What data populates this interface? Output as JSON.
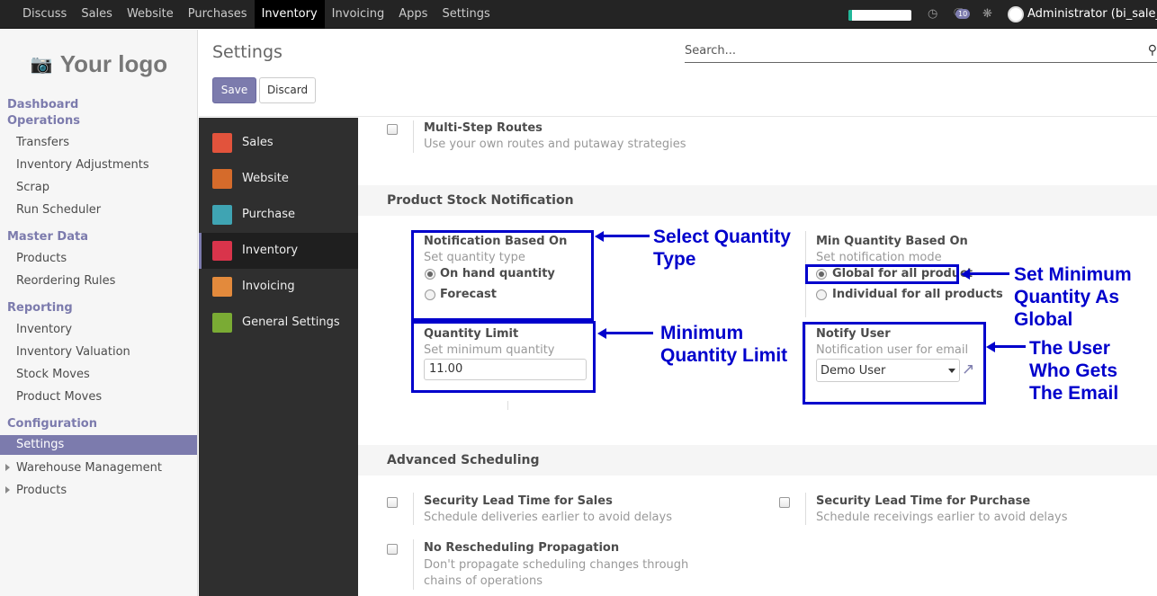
{
  "navbar": {
    "menu": [
      "Discuss",
      "Sales",
      "Website",
      "Purchases",
      "Inventory",
      "Invoicing",
      "Apps",
      "Settings"
    ],
    "active_menu": "Inventory",
    "progress_fraction": 0.05,
    "messages_count": "10",
    "user": "Administrator (bi_sale_..."
  },
  "sidebar": {
    "logo_text": "Your logo",
    "sections": [
      {
        "title": "Dashboard",
        "items": []
      },
      {
        "title": "Operations",
        "items": [
          "Transfers",
          "Inventory Adjustments",
          "Scrap",
          "Run Scheduler"
        ]
      },
      {
        "title": "Master Data",
        "items": [
          "Products",
          "Reordering Rules"
        ]
      },
      {
        "title": "Reporting",
        "items": [
          "Inventory",
          "Inventory Valuation",
          "Stock Moves",
          "Product Moves"
        ]
      },
      {
        "title": "Configuration",
        "items": [
          "Settings"
        ]
      }
    ],
    "active_item": "Settings",
    "tree_items": [
      "Warehouse Management",
      "Products"
    ]
  },
  "control_panel": {
    "title": "Settings",
    "search_placeholder": "Search...",
    "save_label": "Save",
    "discard_label": "Discard"
  },
  "apps": [
    {
      "label": "Sales",
      "color": "#e2533c"
    },
    {
      "label": "Website",
      "color": "#d56b2b"
    },
    {
      "label": "Purchase",
      "color": "#3fa4b3"
    },
    {
      "label": "Inventory",
      "color": "#d9344b"
    },
    {
      "label": "Invoicing",
      "color": "#e38a3c"
    },
    {
      "label": "General Settings",
      "color": "#7aab34"
    }
  ],
  "active_app": "Inventory",
  "content": {
    "multi_step": {
      "title": "Multi-Step Routes",
      "help": "Use your own routes and putaway strategies"
    },
    "stock_notification": {
      "section_title": "Product Stock Notification",
      "notification_based_on": {
        "title": "Notification Based On",
        "help": "Set quantity type",
        "options": [
          "On hand quantity",
          "Forecast"
        ],
        "selected": "On hand quantity"
      },
      "min_qty_based_on": {
        "title": "Min Quantity Based On",
        "help": "Set notification mode",
        "options": [
          "Global for all product",
          "Individual for all products"
        ],
        "selected": "Global for all product"
      },
      "quantity_limit": {
        "title": "Quantity Limit",
        "help": "Set minimum quantity",
        "value": "11.00"
      },
      "notify_user": {
        "title": "Notify User",
        "help": "Notification user for email",
        "value": "Demo User"
      }
    },
    "advanced_scheduling": {
      "section_title": "Advanced Scheduling",
      "items": [
        {
          "title": "Security Lead Time for Sales",
          "help": "Schedule deliveries earlier to avoid delays"
        },
        {
          "title": "Security Lead Time for Purchase",
          "help": "Schedule receivings earlier to avoid delays"
        },
        {
          "title": "No Rescheduling Propagation",
          "help": "Don't propagate scheduling changes through chains of operations"
        }
      ]
    }
  },
  "annotations": {
    "select_qty": [
      "Select Quantity",
      "Type"
    ],
    "min_qty_limit": [
      "Minimum",
      "Quantity Limit"
    ],
    "set_min_global": [
      "Set Minimum",
      "Quantity As",
      "Global"
    ],
    "user_email": [
      "The User",
      "Who Gets",
      "The Email"
    ]
  }
}
